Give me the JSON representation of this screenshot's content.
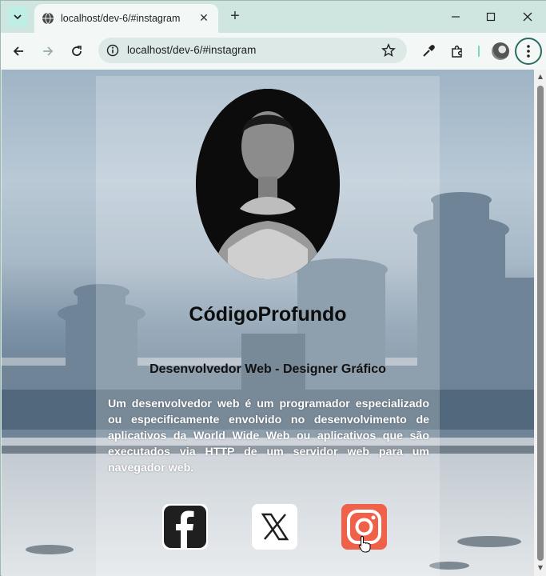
{
  "browser": {
    "tab_title": "localhost/dev-6/#instagram",
    "url": "localhost/dev-6/#instagram",
    "new_tab_symbol": "+",
    "close_symbol": "✕"
  },
  "profile": {
    "name": "CódigoProfundo",
    "role": "Desenvolvedor Web - Designer Gráfico",
    "bio": "Um desenvolvedor web é um programador especializado ou especificamente envolvido no desenvolvimento de aplicativos da World Wide Web ou aplicativos que são executados via HTTP de um servidor web para um navegador web."
  },
  "social": [
    {
      "name": "facebook",
      "icon": "facebook-icon",
      "bg": "#ffffff",
      "fg": "#1f1f1f"
    },
    {
      "name": "x",
      "icon": "x-icon",
      "bg": "#ffffff",
      "fg": "#1f1f1f"
    },
    {
      "name": "instagram",
      "icon": "instagram-icon",
      "bg": "#f0614a",
      "fg": "#ffffff"
    }
  ],
  "colors": {
    "accent": "#2c6b60",
    "instagram_bg": "#f0614a"
  }
}
